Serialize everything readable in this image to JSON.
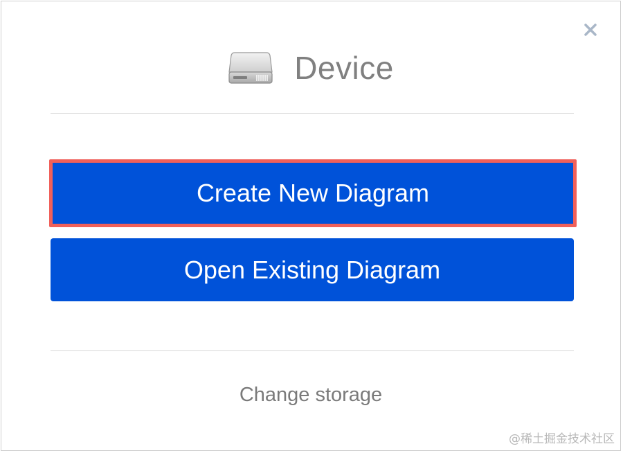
{
  "dialog": {
    "title": "Device",
    "icon": "hard-drive-icon",
    "close_icon": "close-icon"
  },
  "buttons": {
    "create_label": "Create New Diagram",
    "open_label": "Open Existing Diagram"
  },
  "footer": {
    "change_storage_label": "Change storage"
  },
  "watermark": "@稀土掘金技术社区",
  "colors": {
    "button_bg": "#0052d9",
    "highlight_border": "#f0605a",
    "title_text": "#808080",
    "close_icon": "#a9b7c8"
  }
}
